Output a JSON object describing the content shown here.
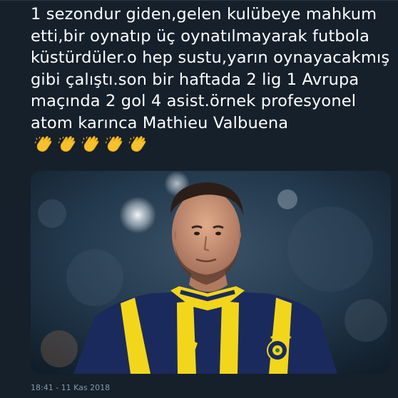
{
  "tweet": {
    "text": "1 sezondur giden,gelen kulübeye mahkum etti,bir oynatıp üç oynatılmayarak futbola küstürdüler.o hep sustu,yarın oynayacakmış gibi çalıştı.son bir haftada 2 lig 1 Avrupa maçında 2 gol 4 asist.örnek profesyonel atom karınca Mathieu Valbuena",
    "emojis": [
      "clapping-hands",
      "clapping-hands",
      "clapping-hands",
      "clapping-hands",
      "clapping-hands"
    ],
    "media": {
      "type": "photo",
      "jersey_colors": [
        "#1b2a5c",
        "#f2d61c"
      ]
    },
    "timestamp": "18:41 - 11 Kas 2018"
  },
  "colors": {
    "background": "#15202b",
    "text": "#ffffff",
    "muted": "#8899a6"
  }
}
